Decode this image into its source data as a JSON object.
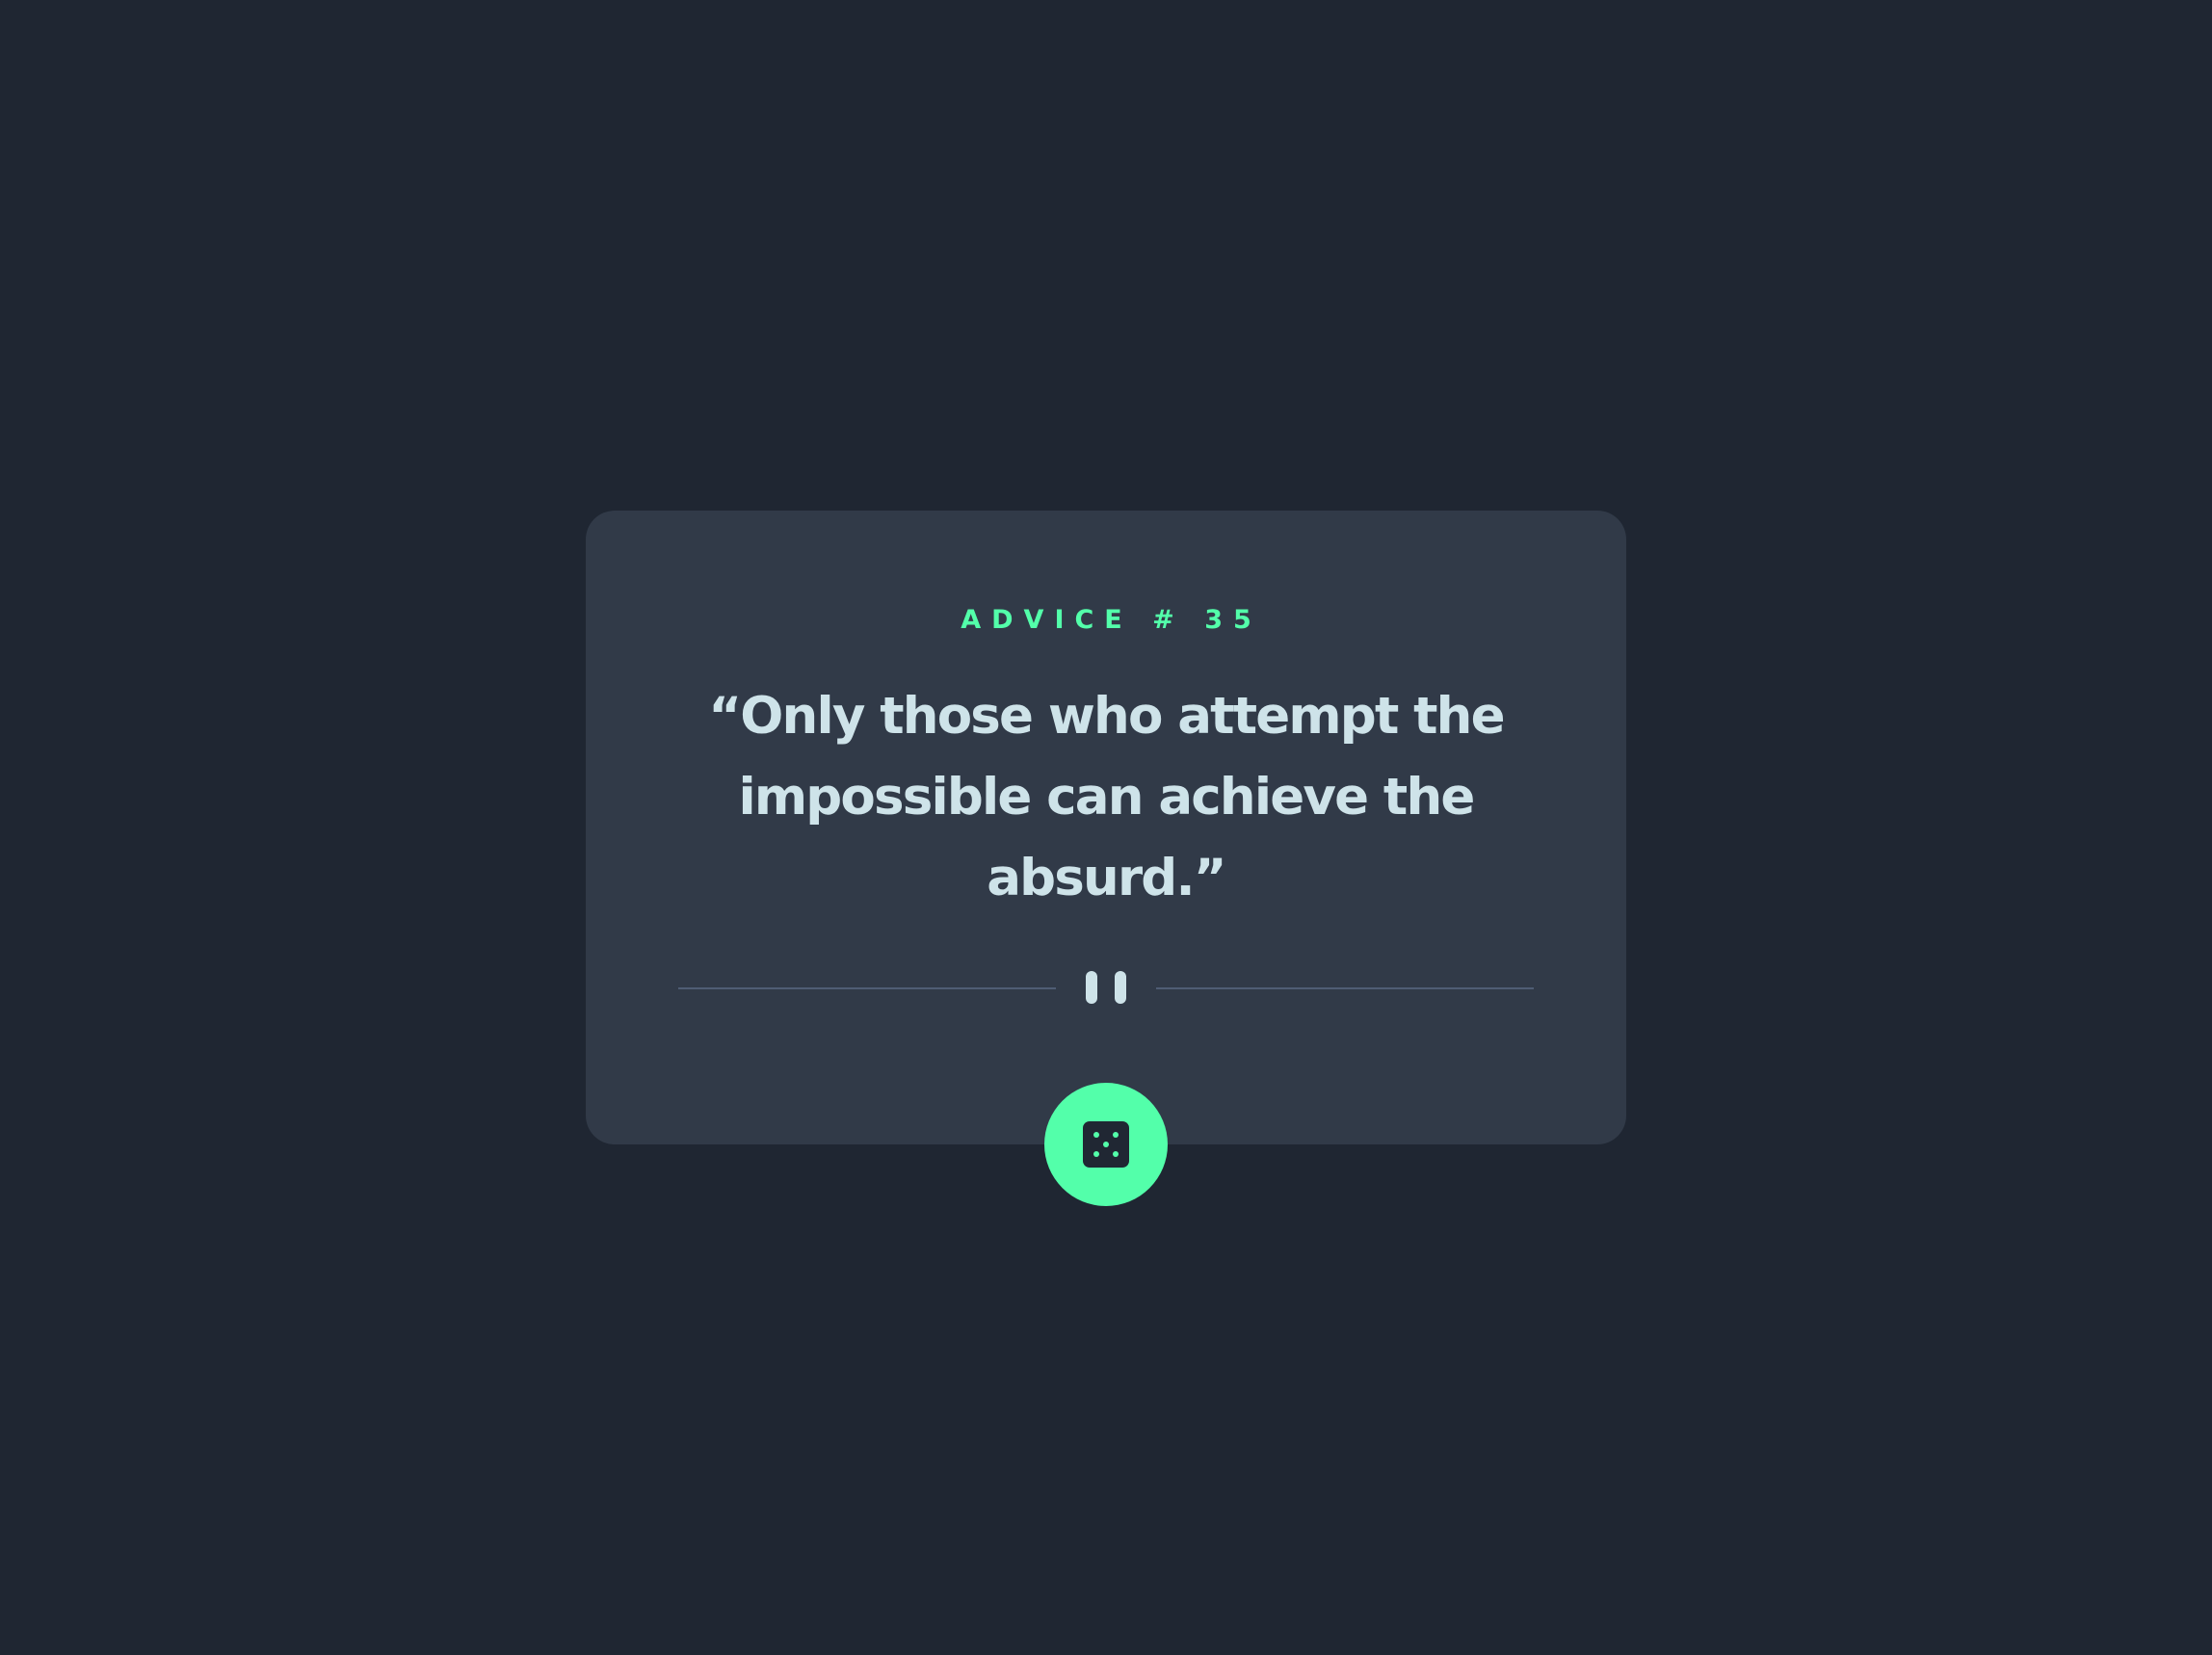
{
  "advice": {
    "label": "ADVICE #",
    "number": "35",
    "quote": "“Only those who attempt the impossible can achieve the absurd.”"
  },
  "icons": {
    "divider": "pause-icon",
    "button": "dice-icon"
  },
  "colors": {
    "background": "#1F2632",
    "card": "#313A48",
    "accent": "#53FFAA",
    "text": "#CEE3E9",
    "divider": "#4F5D74"
  }
}
